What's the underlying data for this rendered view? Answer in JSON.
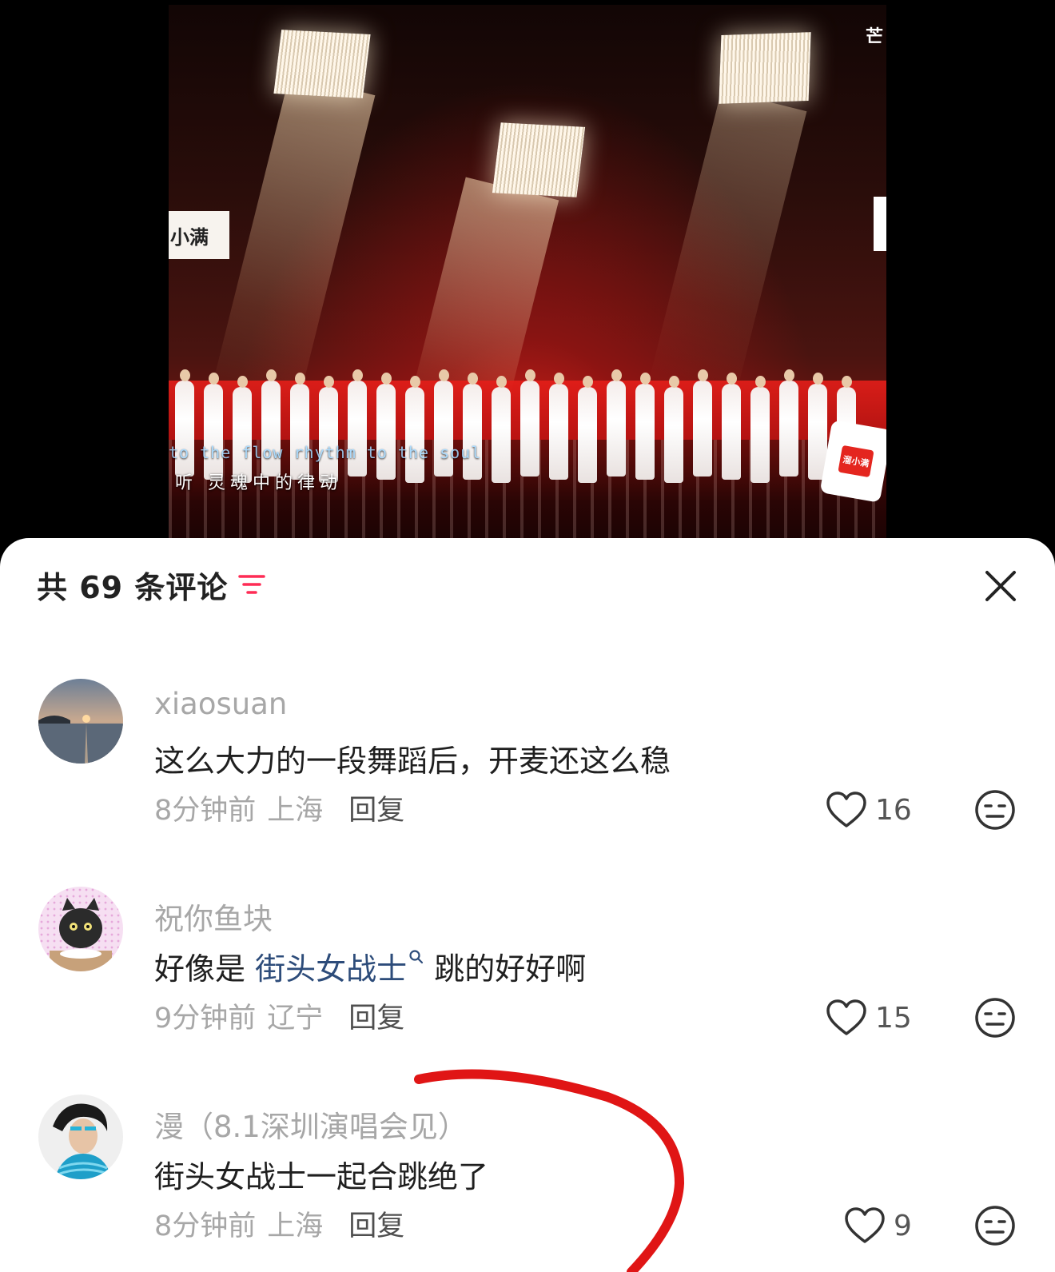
{
  "video": {
    "name_card": "小满",
    "corner_logo": "芒",
    "subtitle_en": "to the flow rhythm to the soul",
    "subtitle_cn": "听 灵魂中的律动",
    "sponsor_label": "溜小满"
  },
  "sheet": {
    "title": "共 69 条评论"
  },
  "comments": [
    {
      "username": "xiaosuan",
      "text": "这么大力的一段舞蹈后，开麦还这么稳",
      "time": "8分钟前",
      "location": "上海",
      "reply_label": "回复",
      "likes": "16"
    },
    {
      "username": "祝你鱼块",
      "text_before": "好像是 ",
      "mention": "街头女战士",
      "text_after": " 跳的好好啊",
      "time": "9分钟前",
      "location": "辽宁",
      "reply_label": "回复",
      "likes": "15"
    },
    {
      "username": "漫（8.1深圳演唱会见）",
      "text": "街头女战士一起合跳绝了",
      "time": "8分钟前",
      "location": "上海",
      "reply_label": "回复",
      "likes": "9"
    }
  ],
  "colors": {
    "annotation_stroke": "#e01515",
    "accent": "#fe2c55",
    "mention": "#2d4c7a"
  }
}
